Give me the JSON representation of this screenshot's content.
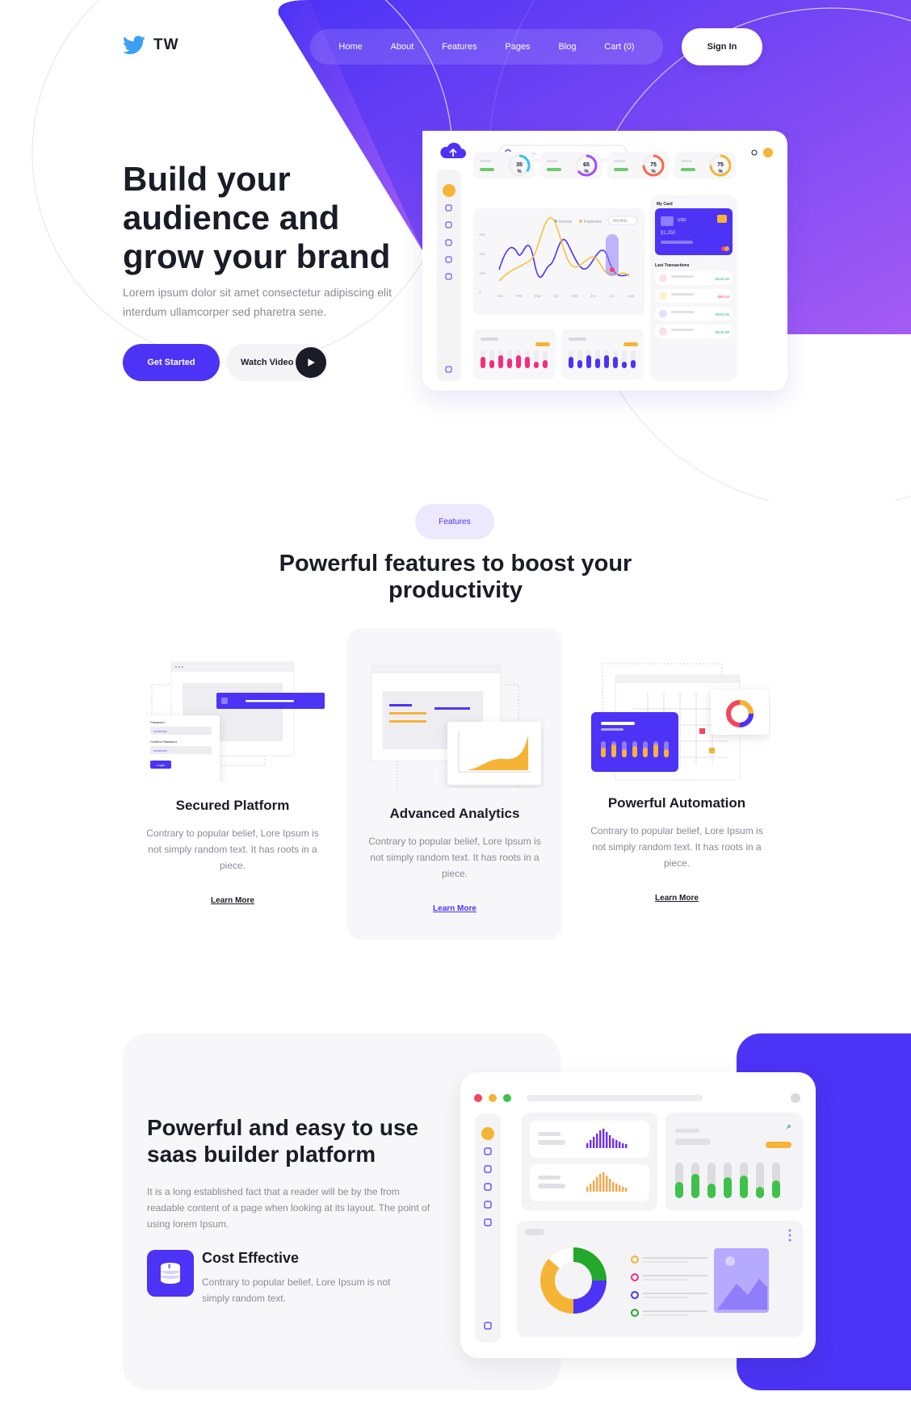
{
  "brand": {
    "name": "TW",
    "accent": "#4c33f5",
    "gradient_end": "#a45cf3"
  },
  "nav": {
    "items": [
      "Home",
      "About",
      "Features",
      "Pages",
      "Blog",
      "Cart (0)"
    ],
    "sign_in": "Sign In"
  },
  "hero": {
    "title": "Build your audience and grow your brand",
    "subtitle": "Lorem ipsum dolor sit amet consectetur adipiscing elit interdum ullamcorper sed pharetra sene.",
    "cta_primary": "Get Started",
    "cta_video": "Watch Video"
  },
  "dashboard": {
    "search_placeholder": "Search here...",
    "gauges": [
      {
        "value": "35",
        "unit": "%",
        "color": "#35c4e8"
      },
      {
        "value": "65",
        "unit": "%",
        "color": "#a44cf5"
      },
      {
        "value": "75",
        "unit": "%",
        "color": "#f56a4c"
      },
      {
        "value": "75",
        "unit": "%",
        "color": "#f5b435"
      }
    ],
    "chart_legend": [
      "Income",
      "Expenses"
    ],
    "chart_filter": "Monthly",
    "y_ticks": [
      "20K",
      "15K",
      "10K",
      "0"
    ],
    "x_ticks": [
      "Jan",
      "Feb",
      "Mar",
      "Apr",
      "May",
      "Jun",
      "Jul",
      "Aug"
    ],
    "card_title": "My Card",
    "card_label": "USD",
    "card_amount": "$1,250",
    "transactions_title": "Last Transactions",
    "transactions": [
      "+$120.00",
      "-$85.20",
      "+$424.00",
      "+$120.00"
    ],
    "transaction_colors": [
      "#22b573",
      "#f5455c",
      "#22b573",
      "#22b573"
    ]
  },
  "features": {
    "tag": "Features",
    "heading": "Powerful features to boost your productivity",
    "items": [
      {
        "title": "Secured Platform",
        "text": "Contrary to popular belief, Lore Ipsum is not simply random text. It has roots in a piece.",
        "link": "Learn More",
        "login_button": "Login",
        "field_label_1": "Password",
        "field_label_2": "Confirm Password"
      },
      {
        "title": "Advanced Analytics",
        "text": "Contrary to popular belief, Lore Ipsum is not simply random text. It has roots in a piece.",
        "link": "Learn More"
      },
      {
        "title": "Powerful Automation",
        "text": "Contrary to popular belief, Lore Ipsum is not simply random text. It has roots in a piece.",
        "link": "Learn More"
      }
    ]
  },
  "builder": {
    "heading": "Powerful and easy to use saas builder platform",
    "text": "It is a long established fact that a reader will be by the from readable content of a page when looking at its layout. The point of using lorem Ipsum.",
    "feature_title": "Cost Effective",
    "feature_text": "Contrary to popular belief, Lore Ipsum is not simply random text."
  }
}
